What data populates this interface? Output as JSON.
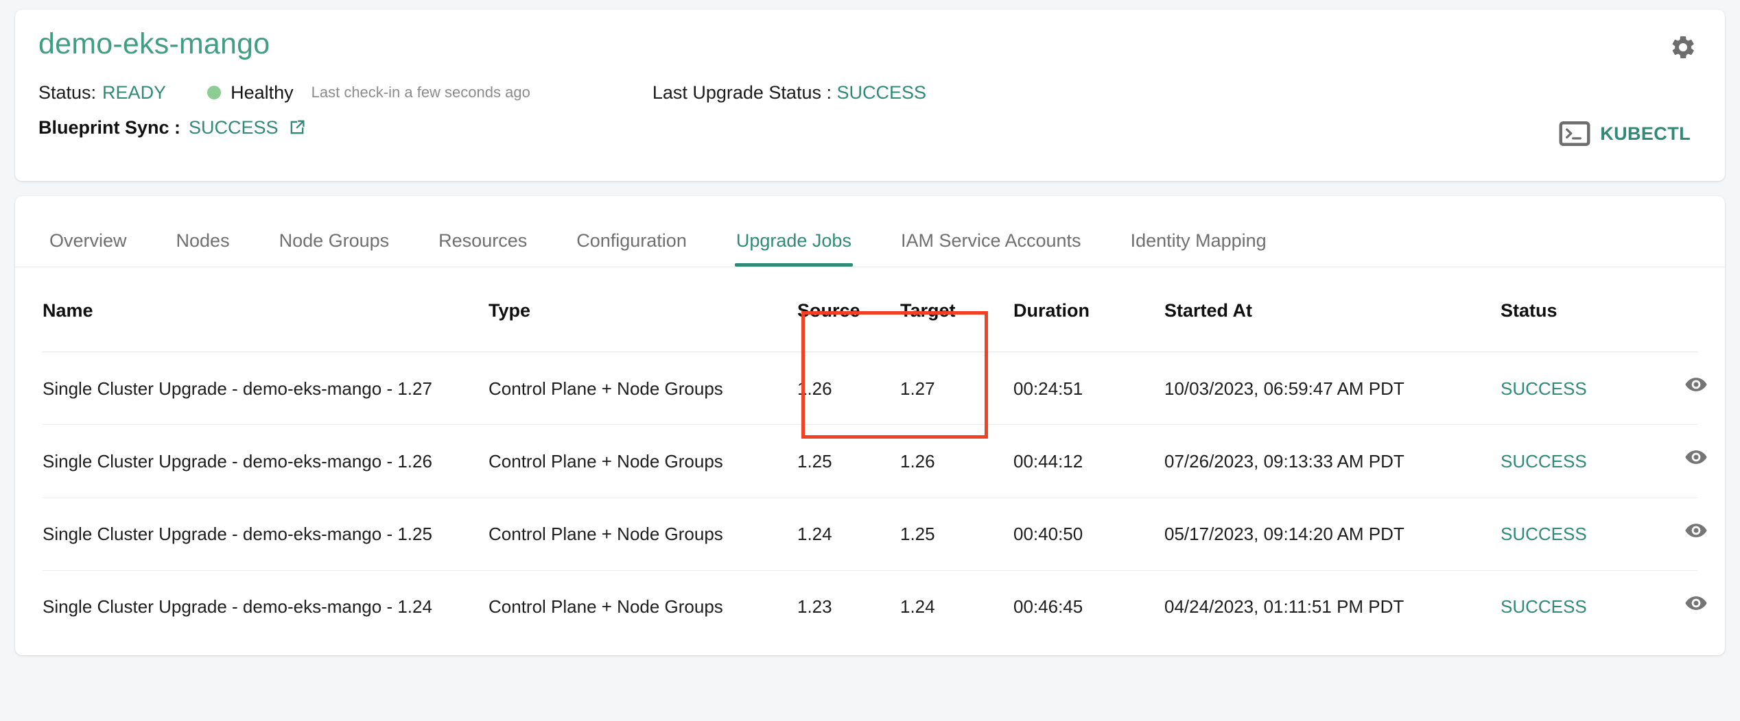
{
  "header": {
    "cluster_name": "demo-eks-mango",
    "status_label": "Status:",
    "status_value": "READY",
    "health_text": "Healthy",
    "checkin_text": "Last check-in a few seconds ago",
    "last_upgrade_label": "Last Upgrade Status : ",
    "last_upgrade_value": "SUCCESS",
    "blueprint_sync_label": "Blueprint Sync :",
    "blueprint_sync_value": "SUCCESS",
    "kubectl_label": "KUBECTL",
    "gear_icon": "gear-icon",
    "external_link_icon": "external-link-icon",
    "terminal_icon": "terminal-icon",
    "health_dot_color": "#8dcd95",
    "accent_color": "#2f8a77",
    "title_color": "#3f9e84"
  },
  "tabs": [
    {
      "label": "Overview",
      "active": false
    },
    {
      "label": "Nodes",
      "active": false
    },
    {
      "label": "Node Groups",
      "active": false
    },
    {
      "label": "Resources",
      "active": false
    },
    {
      "label": "Configuration",
      "active": false
    },
    {
      "label": "Upgrade Jobs",
      "active": true
    },
    {
      "label": "IAM Service Accounts",
      "active": false
    },
    {
      "label": "Identity Mapping",
      "active": false
    }
  ],
  "table": {
    "columns": [
      "Name",
      "Type",
      "Source",
      "Target",
      "Duration",
      "Started At",
      "Status"
    ],
    "rows": [
      {
        "name": "Single Cluster Upgrade - demo-eks-mango - 1.27",
        "type": "Control Plane + Node Groups",
        "source": "1.26",
        "target": "1.27",
        "duration": "00:24:51",
        "started_at": "10/03/2023, 06:59:47 AM PDT",
        "status": "SUCCESS",
        "action_icon": "eye-icon"
      },
      {
        "name": "Single Cluster Upgrade - demo-eks-mango - 1.26",
        "type": "Control Plane + Node Groups",
        "source": "1.25",
        "target": "1.26",
        "duration": "00:44:12",
        "started_at": "07/26/2023, 09:13:33 AM PDT",
        "status": "SUCCESS",
        "action_icon": "eye-icon"
      },
      {
        "name": "Single Cluster Upgrade - demo-eks-mango - 1.25",
        "type": "Control Plane + Node Groups",
        "source": "1.24",
        "target": "1.25",
        "duration": "00:40:50",
        "started_at": "05/17/2023, 09:14:20 AM PDT",
        "status": "SUCCESS",
        "action_icon": "eye-icon"
      },
      {
        "name": "Single Cluster Upgrade - demo-eks-mango - 1.24",
        "type": "Control Plane + Node Groups",
        "source": "1.23",
        "target": "1.24",
        "duration": "00:46:45",
        "started_at": "04/24/2023, 01:11:51 PM PDT",
        "status": "SUCCESS",
        "action_icon": "eye-icon"
      }
    ]
  },
  "annotation": {
    "color": "#f04124",
    "covers": "Source and Target columns, header through first row"
  }
}
